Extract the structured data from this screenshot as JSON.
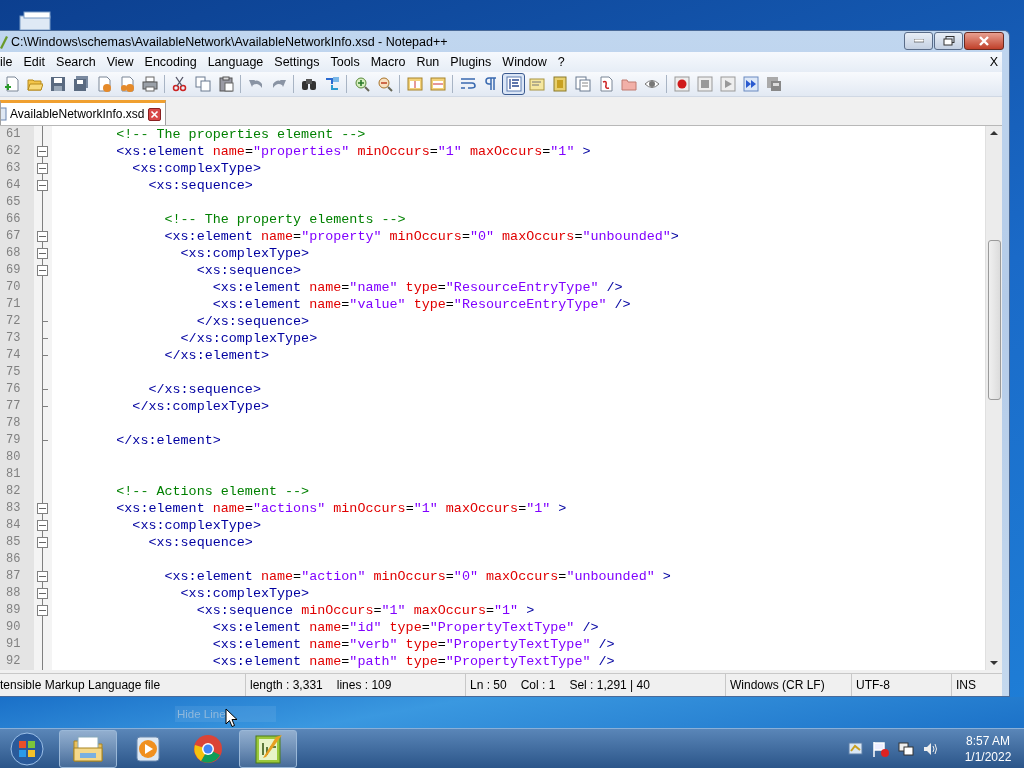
{
  "desktop": {
    "tooltip": "Hide Line"
  },
  "window": {
    "title": "C:\\Windows\\schemas\\AvailableNetwork\\AvailableNetworkInfo.xsd - Notepad++",
    "menu": [
      "ile",
      "Edit",
      "Search",
      "View",
      "Encoding",
      "Language",
      "Settings",
      "Tools",
      "Macro",
      "Run",
      "Plugins",
      "Window",
      "?"
    ],
    "menu_close": "X",
    "toolbar": [
      {
        "buttons": [
          {
            "kind": "new",
            "selected": false
          },
          {
            "kind": "open",
            "selected": false
          },
          {
            "kind": "save",
            "selected": false
          },
          {
            "kind": "save-all",
            "selected": false
          },
          {
            "kind": "close",
            "selected": false
          },
          {
            "kind": "close-all",
            "selected": false
          },
          {
            "kind": "print",
            "selected": false
          }
        ]
      },
      {
        "buttons": [
          {
            "kind": "cut",
            "selected": false
          },
          {
            "kind": "copy",
            "selected": false
          },
          {
            "kind": "paste",
            "selected": false
          }
        ]
      },
      {
        "buttons": [
          {
            "kind": "undo",
            "selected": false
          },
          {
            "kind": "redo",
            "selected": false
          }
        ]
      },
      {
        "buttons": [
          {
            "kind": "find",
            "selected": false
          },
          {
            "kind": "replace",
            "selected": false
          }
        ]
      },
      {
        "buttons": [
          {
            "kind": "zoom-in",
            "selected": false
          },
          {
            "kind": "zoom-out",
            "selected": false
          }
        ]
      },
      {
        "buttons": [
          {
            "kind": "sync-v",
            "selected": false
          },
          {
            "kind": "sync-h",
            "selected": false
          }
        ]
      },
      {
        "buttons": [
          {
            "kind": "wrap",
            "selected": false
          },
          {
            "kind": "all-chars",
            "selected": false
          },
          {
            "kind": "indent-guide",
            "selected": true
          },
          {
            "kind": "udl",
            "selected": false
          },
          {
            "kind": "doc-map",
            "selected": false
          },
          {
            "kind": "function-list",
            "selected": false
          },
          {
            "kind": "workspace",
            "selected": false
          },
          {
            "kind": "folder",
            "selected": false
          },
          {
            "kind": "monitor",
            "selected": false
          }
        ]
      },
      {
        "buttons": [
          {
            "kind": "record",
            "selected": false
          },
          {
            "kind": "stop",
            "selected": false
          },
          {
            "kind": "play",
            "selected": false
          },
          {
            "kind": "play-multi",
            "selected": false
          },
          {
            "kind": "save-macro",
            "selected": false
          }
        ]
      }
    ],
    "tabs": [
      {
        "label": "AvailableNetworkInfo.xsd",
        "selected": true
      }
    ],
    "editor": {
      "lines": [
        {
          "number": "61",
          "kind": "plain",
          "tokens": [
            {
              "kind": "comment",
              "text": "        <!-- The properties element -->"
            }
          ]
        },
        {
          "number": "62",
          "kind": "fold-start",
          "tokens": [
            {
              "kind": "tag",
              "text": "        <xs:element "
            },
            {
              "kind": "attr",
              "text": "name"
            },
            {
              "kind": "plain",
              "text": "="
            },
            {
              "kind": "value",
              "text": "\"properties\" "
            },
            {
              "kind": "attr",
              "text": "minOccurs"
            },
            {
              "kind": "plain",
              "text": "="
            },
            {
              "kind": "value",
              "text": "\"1\" "
            },
            {
              "kind": "attr",
              "text": "maxOccurs"
            },
            {
              "kind": "plain",
              "text": "="
            },
            {
              "kind": "value",
              "text": "\"1\" "
            },
            {
              "kind": "tag",
              "text": ">"
            }
          ]
        },
        {
          "number": "63",
          "kind": "fold-start",
          "tokens": [
            {
              "kind": "tag",
              "text": "          <xs:complexType>"
            }
          ]
        },
        {
          "number": "64",
          "kind": "fold-start",
          "tokens": [
            {
              "kind": "tag",
              "text": "            <xs:sequence>"
            }
          ]
        },
        {
          "number": "65",
          "kind": "plain"
        },
        {
          "number": "66",
          "kind": "plain",
          "tokens": [
            {
              "kind": "comment",
              "text": "              <!-- The property elements -->"
            }
          ]
        },
        {
          "number": "67",
          "kind": "fold-start",
          "tokens": [
            {
              "kind": "tag",
              "text": "              <xs:element "
            },
            {
              "kind": "attr",
              "text": "name"
            },
            {
              "kind": "plain",
              "text": "="
            },
            {
              "kind": "value",
              "text": "\"property\" "
            },
            {
              "kind": "attr",
              "text": "minOccurs"
            },
            {
              "kind": "plain",
              "text": "="
            },
            {
              "kind": "value",
              "text": "\"0\" "
            },
            {
              "kind": "attr",
              "text": "maxOccurs"
            },
            {
              "kind": "plain",
              "text": "="
            },
            {
              "kind": "value",
              "text": "\"unbounded\""
            },
            {
              "kind": "tag",
              "text": ">"
            }
          ]
        },
        {
          "number": "68",
          "kind": "fold-start",
          "tokens": [
            {
              "kind": "tag",
              "text": "                <xs:complexType>"
            }
          ]
        },
        {
          "number": "69",
          "kind": "fold-start",
          "tokens": [
            {
              "kind": "tag",
              "text": "                  <xs:sequence>"
            }
          ]
        },
        {
          "number": "70",
          "kind": "plain",
          "tokens": [
            {
              "kind": "tag",
              "text": "                    <xs:element "
            },
            {
              "kind": "attr",
              "text": "name"
            },
            {
              "kind": "plain",
              "text": "="
            },
            {
              "kind": "value",
              "text": "\"name\" "
            },
            {
              "kind": "attr",
              "text": "type"
            },
            {
              "kind": "plain",
              "text": "="
            },
            {
              "kind": "value",
              "text": "\"ResourceEntryType\" "
            },
            {
              "kind": "tag",
              "text": "/>"
            }
          ]
        },
        {
          "number": "71",
          "kind": "plain",
          "tokens": [
            {
              "kind": "tag",
              "text": "                    <xs:element "
            },
            {
              "kind": "attr",
              "text": "name"
            },
            {
              "kind": "plain",
              "text": "="
            },
            {
              "kind": "value",
              "text": "\"value\" "
            },
            {
              "kind": "attr",
              "text": "type"
            },
            {
              "kind": "plain",
              "text": "="
            },
            {
              "kind": "value",
              "text": "\"ResourceEntryType\" "
            },
            {
              "kind": "tag",
              "text": "/>"
            }
          ]
        },
        {
          "number": "72",
          "kind": "fold-end",
          "tokens": [
            {
              "kind": "tag",
              "text": "                  </xs:sequence>"
            }
          ]
        },
        {
          "number": "73",
          "kind": "fold-end",
          "tokens": [
            {
              "kind": "tag",
              "text": "                </xs:complexType>"
            }
          ]
        },
        {
          "number": "74",
          "kind": "fold-end",
          "tokens": [
            {
              "kind": "tag",
              "text": "              </xs:element>"
            }
          ]
        },
        {
          "number": "75",
          "kind": "plain"
        },
        {
          "number": "76",
          "kind": "fold-end",
          "tokens": [
            {
              "kind": "tag",
              "text": "            </xs:sequence>"
            }
          ]
        },
        {
          "number": "77",
          "kind": "fold-end",
          "tokens": [
            {
              "kind": "tag",
              "text": "          </xs:complexType>"
            }
          ]
        },
        {
          "number": "78",
          "kind": "plain"
        },
        {
          "number": "79",
          "kind": "fold-end",
          "tokens": [
            {
              "kind": "tag",
              "text": "        </xs:element>"
            }
          ]
        },
        {
          "number": "80",
          "kind": "plain"
        },
        {
          "number": "81",
          "kind": "plain"
        },
        {
          "number": "82",
          "kind": "plain",
          "tokens": [
            {
              "kind": "comment",
              "text": "        <!-- Actions element -->"
            }
          ]
        },
        {
          "number": "83",
          "kind": "fold-start",
          "tokens": [
            {
              "kind": "tag",
              "text": "        <xs:element "
            },
            {
              "kind": "attr",
              "text": "name"
            },
            {
              "kind": "plain",
              "text": "="
            },
            {
              "kind": "value",
              "text": "\"actions\" "
            },
            {
              "kind": "attr",
              "text": "minOccurs"
            },
            {
              "kind": "plain",
              "text": "="
            },
            {
              "kind": "value",
              "text": "\"1\" "
            },
            {
              "kind": "attr",
              "text": "maxOccurs"
            },
            {
              "kind": "plain",
              "text": "="
            },
            {
              "kind": "value",
              "text": "\"1\" "
            },
            {
              "kind": "tag",
              "text": ">"
            }
          ]
        },
        {
          "number": "84",
          "kind": "fold-start",
          "tokens": [
            {
              "kind": "tag",
              "text": "          <xs:complexType>"
            }
          ]
        },
        {
          "number": "85",
          "kind": "fold-start",
          "tokens": [
            {
              "kind": "tag",
              "text": "            <xs:sequence>"
            }
          ]
        },
        {
          "number": "86",
          "kind": "plain"
        },
        {
          "number": "87",
          "kind": "fold-start",
          "tokens": [
            {
              "kind": "tag",
              "text": "              <xs:element "
            },
            {
              "kind": "attr",
              "text": "name"
            },
            {
              "kind": "plain",
              "text": "="
            },
            {
              "kind": "value",
              "text": "\"action\" "
            },
            {
              "kind": "attr",
              "text": "minOccurs"
            },
            {
              "kind": "plain",
              "text": "="
            },
            {
              "kind": "value",
              "text": "\"0\" "
            },
            {
              "kind": "attr",
              "text": "maxOccurs"
            },
            {
              "kind": "plain",
              "text": "="
            },
            {
              "kind": "value",
              "text": "\"unbounded\" "
            },
            {
              "kind": "tag",
              "text": ">"
            }
          ]
        },
        {
          "number": "88",
          "kind": "fold-start",
          "tokens": [
            {
              "kind": "tag",
              "text": "                <xs:complexType>"
            }
          ]
        },
        {
          "number": "89",
          "kind": "fold-start",
          "tokens": [
            {
              "kind": "tag",
              "text": "                  <xs:sequence "
            },
            {
              "kind": "attr",
              "text": "minOccurs"
            },
            {
              "kind": "plain",
              "text": "="
            },
            {
              "kind": "value",
              "text": "\"1\" "
            },
            {
              "kind": "attr",
              "text": "maxOccurs"
            },
            {
              "kind": "plain",
              "text": "="
            },
            {
              "kind": "value",
              "text": "\"1\" "
            },
            {
              "kind": "tag",
              "text": ">"
            }
          ]
        },
        {
          "number": "90",
          "kind": "plain",
          "tokens": [
            {
              "kind": "tag",
              "text": "                    <xs:element "
            },
            {
              "kind": "attr",
              "text": "name"
            },
            {
              "kind": "plain",
              "text": "="
            },
            {
              "kind": "value",
              "text": "\"id\" "
            },
            {
              "kind": "attr",
              "text": "type"
            },
            {
              "kind": "plain",
              "text": "="
            },
            {
              "kind": "value",
              "text": "\"PropertyTextType\" "
            },
            {
              "kind": "tag",
              "text": "/>"
            }
          ]
        },
        {
          "number": "91",
          "kind": "plain",
          "tokens": [
            {
              "kind": "tag",
              "text": "                    <xs:element "
            },
            {
              "kind": "attr",
              "text": "name"
            },
            {
              "kind": "plain",
              "text": "="
            },
            {
              "kind": "value",
              "text": "\"verb\" "
            },
            {
              "kind": "attr",
              "text": "type"
            },
            {
              "kind": "plain",
              "text": "="
            },
            {
              "kind": "value",
              "text": "\"PropertyTextType\" "
            },
            {
              "kind": "tag",
              "text": "/>"
            }
          ]
        },
        {
          "number": "92",
          "kind": "plain",
          "tokens": [
            {
              "kind": "tag",
              "text": "                    <xs:element "
            },
            {
              "kind": "attr",
              "text": "name"
            },
            {
              "kind": "plain",
              "text": "="
            },
            {
              "kind": "value",
              "text": "\"path\" "
            },
            {
              "kind": "attr",
              "text": "type"
            },
            {
              "kind": "plain",
              "text": "="
            },
            {
              "kind": "value",
              "text": "\"PropertyTextType\" "
            },
            {
              "kind": "tag",
              "text": "/>"
            }
          ]
        }
      ]
    },
    "status_bar": [
      {
        "items": [
          "tensible Markup Language file"
        ]
      },
      {
        "items": [
          "length : 3,331",
          "lines : 109"
        ]
      },
      {
        "items": [
          "Ln : 50",
          "Col : 1",
          "Sel : 1,291 | 40"
        ]
      },
      {
        "items": [
          "Windows (CR LF)"
        ]
      },
      {
        "items": [
          "UTF-8"
        ]
      },
      {
        "items": [
          "INS"
        ]
      }
    ]
  },
  "taskbar": {
    "items": [
      {
        "kind": "explorer",
        "running": true
      },
      {
        "kind": "media",
        "running": false
      },
      {
        "kind": "browser",
        "running": false
      },
      {
        "kind": "notepad",
        "running": true
      }
    ],
    "clock": {
      "time": "8:57 AM",
      "date": "1/1/2022"
    }
  }
}
